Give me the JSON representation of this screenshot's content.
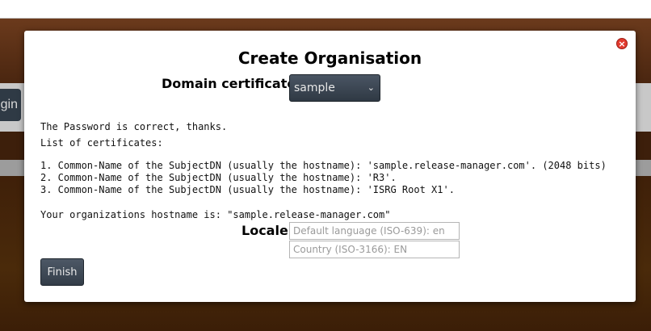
{
  "background": {
    "partial_button_label": "gin"
  },
  "modal": {
    "title": "Create Organisation",
    "close_symbol": "×",
    "domain_certificate_label": "Domain certificate:",
    "domain_certificate_value": "sample",
    "password_message": "The Password is correct, thanks.",
    "cert_list_heading": "List of certificates:",
    "certificates": [
      "1. Common-Name of the SubjectDN (usually the hostname): 'sample.release-manager.com'. (2048 bits)",
      "2. Common-Name of the SubjectDN (usually the hostname): 'R3'.",
      "3. Common-Name of the SubjectDN (usually the hostname): 'ISRG Root X1'."
    ],
    "hostname_message": "Your organizations hostname is: \"sample.release-manager.com\"",
    "locale_label": "Locale:",
    "language_placeholder": "Default language (ISO-639): en",
    "language_value": "",
    "country_placeholder": "Country (ISO-3166): EN",
    "country_value": "",
    "finish_label": "Finish"
  },
  "colors": {
    "accent_button": "#3b4550",
    "close_button": "#e23a2e",
    "background_brown": "#3a1d08"
  }
}
